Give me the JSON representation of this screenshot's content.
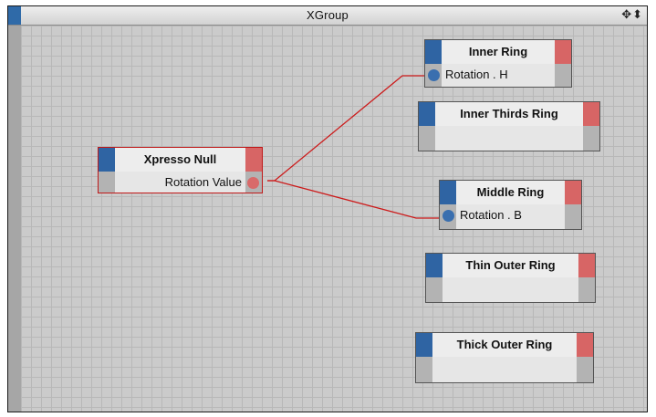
{
  "window": {
    "title": "XGroup",
    "title_icons": "✥⬍"
  },
  "colors": {
    "wire": "#cc1a1a",
    "port_in": "#3a6faf",
    "port_out": "#d96a6a",
    "node_selected_border": "#c01818"
  },
  "nodes": {
    "xpresso_null": {
      "title": "Xpresso Null",
      "port": "Rotation Value",
      "selected": true
    },
    "inner_ring": {
      "title": "Inner Ring",
      "port": "Rotation . H"
    },
    "inner_thirds_ring": {
      "title": "Inner Thirds Ring"
    },
    "middle_ring": {
      "title": "Middle Ring",
      "port": "Rotation . B"
    },
    "thin_outer_ring": {
      "title": "Thin Outer Ring"
    },
    "thick_outer_ring": {
      "title": "Thick Outer Ring"
    }
  },
  "connections": [
    {
      "from": "xpresso_null.Rotation Value",
      "to": "inner_ring.Rotation . H"
    },
    {
      "from": "xpresso_null.Rotation Value",
      "to": "middle_ring.Rotation . B"
    }
  ]
}
